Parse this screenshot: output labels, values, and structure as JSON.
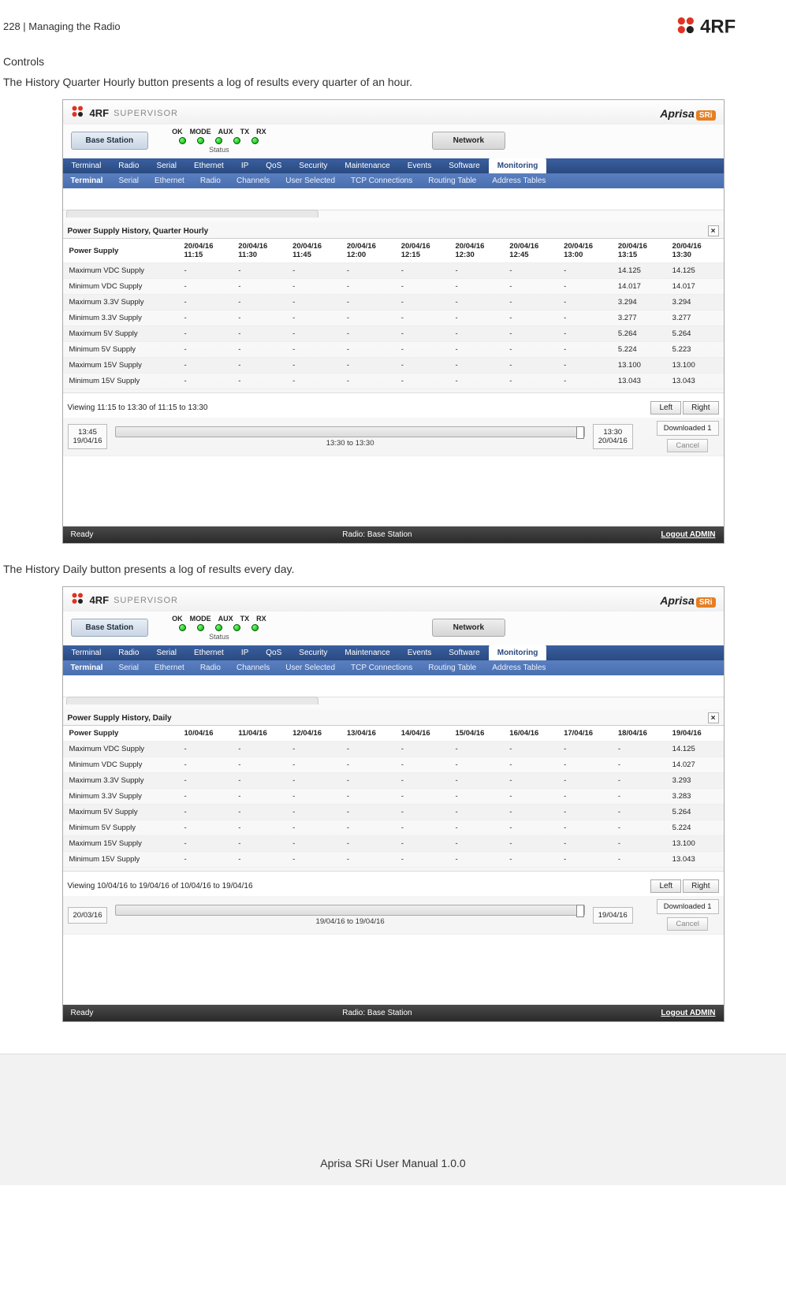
{
  "page_header": {
    "left": "228  |  Managing the Radio"
  },
  "section1": {
    "heading": "Controls",
    "desc": "The History Quarter Hourly button presents a log of results every quarter of an hour."
  },
  "section2": {
    "desc": "The History Daily button presents a log of results every day."
  },
  "app_common": {
    "supervisor": "SUPERVISOR",
    "brand": "Aprisa",
    "brand_suffix": "SRi",
    "base_btn": "Base Station",
    "network_btn": "Network",
    "status_label": "Status",
    "leds": [
      "OK",
      "MODE",
      "AUX",
      "TX",
      "RX"
    ],
    "nav": [
      "Terminal",
      "Radio",
      "Serial",
      "Ethernet",
      "IP",
      "QoS",
      "Security",
      "Maintenance",
      "Events",
      "Software",
      "Monitoring"
    ],
    "subnav": [
      "Terminal",
      "Serial",
      "Ethernet",
      "Radio",
      "Channels",
      "User Selected",
      "TCP Connections",
      "Routing Table",
      "Address Tables"
    ],
    "close_x": "×",
    "left": "Left",
    "right": "Right",
    "downloaded": "Downloaded 1",
    "cancel": "Cancel",
    "ready": "Ready",
    "radio_base": "Radio: Base Station",
    "logout": "Logout ADMIN"
  },
  "panel1": {
    "title": "Power Supply History, Quarter Hourly",
    "row_header": "Power Supply",
    "cols": [
      "20/04/16 11:15",
      "20/04/16 11:30",
      "20/04/16 11:45",
      "20/04/16 12:00",
      "20/04/16 12:15",
      "20/04/16 12:30",
      "20/04/16 12:45",
      "20/04/16 13:00",
      "20/04/16 13:15",
      "20/04/16 13:30"
    ],
    "rows": [
      {
        "name": "Maximum VDC Supply",
        "v": [
          "-",
          "-",
          "-",
          "-",
          "-",
          "-",
          "-",
          "-",
          "14.125",
          "14.125"
        ]
      },
      {
        "name": "Minimum VDC Supply",
        "v": [
          "-",
          "-",
          "-",
          "-",
          "-",
          "-",
          "-",
          "-",
          "14.017",
          "14.017"
        ]
      },
      {
        "name": "Maximum 3.3V Supply",
        "v": [
          "-",
          "-",
          "-",
          "-",
          "-",
          "-",
          "-",
          "-",
          "3.294",
          "3.294"
        ]
      },
      {
        "name": "Minimum 3.3V Supply",
        "v": [
          "-",
          "-",
          "-",
          "-",
          "-",
          "-",
          "-",
          "-",
          "3.277",
          "3.277"
        ]
      },
      {
        "name": "Maximum 5V Supply",
        "v": [
          "-",
          "-",
          "-",
          "-",
          "-",
          "-",
          "-",
          "-",
          "5.264",
          "5.264"
        ]
      },
      {
        "name": "Minimum 5V Supply",
        "v": [
          "-",
          "-",
          "-",
          "-",
          "-",
          "-",
          "-",
          "-",
          "5.224",
          "5.223"
        ]
      },
      {
        "name": "Maximum 15V Supply",
        "v": [
          "-",
          "-",
          "-",
          "-",
          "-",
          "-",
          "-",
          "-",
          "13.100",
          "13.100"
        ]
      },
      {
        "name": "Minimum 15V Supply",
        "v": [
          "-",
          "-",
          "-",
          "-",
          "-",
          "-",
          "-",
          "-",
          "13.043",
          "13.043"
        ]
      }
    ],
    "viewing": "Viewing 11:15 to 13:30 of 11:15 to 13:30",
    "slider_left_top": "13:45",
    "slider_left_bottom": "19/04/16",
    "slider_right_top": "13:30",
    "slider_right_bottom": "20/04/16",
    "slider_caption": "13:30 to 13:30"
  },
  "panel2": {
    "title": "Power Supply History, Daily",
    "row_header": "Power Supply",
    "cols": [
      "10/04/16",
      "11/04/16",
      "12/04/16",
      "13/04/16",
      "14/04/16",
      "15/04/16",
      "16/04/16",
      "17/04/16",
      "18/04/16",
      "19/04/16"
    ],
    "rows": [
      {
        "name": "Maximum VDC Supply",
        "v": [
          "-",
          "-",
          "-",
          "-",
          "-",
          "-",
          "-",
          "-",
          "-",
          "14.125"
        ]
      },
      {
        "name": "Minimum VDC Supply",
        "v": [
          "-",
          "-",
          "-",
          "-",
          "-",
          "-",
          "-",
          "-",
          "-",
          "14.027"
        ]
      },
      {
        "name": "Maximum 3.3V Supply",
        "v": [
          "-",
          "-",
          "-",
          "-",
          "-",
          "-",
          "-",
          "-",
          "-",
          "3.293"
        ]
      },
      {
        "name": "Minimum 3.3V Supply",
        "v": [
          "-",
          "-",
          "-",
          "-",
          "-",
          "-",
          "-",
          "-",
          "-",
          "3.283"
        ]
      },
      {
        "name": "Maximum 5V Supply",
        "v": [
          "-",
          "-",
          "-",
          "-",
          "-",
          "-",
          "-",
          "-",
          "-",
          "5.264"
        ]
      },
      {
        "name": "Minimum 5V Supply",
        "v": [
          "-",
          "-",
          "-",
          "-",
          "-",
          "-",
          "-",
          "-",
          "-",
          "5.224"
        ]
      },
      {
        "name": "Maximum 15V Supply",
        "v": [
          "-",
          "-",
          "-",
          "-",
          "-",
          "-",
          "-",
          "-",
          "-",
          "13.100"
        ]
      },
      {
        "name": "Minimum 15V Supply",
        "v": [
          "-",
          "-",
          "-",
          "-",
          "-",
          "-",
          "-",
          "-",
          "-",
          "13.043"
        ]
      }
    ],
    "viewing": "Viewing 10/04/16 to 19/04/16 of 10/04/16 to 19/04/16",
    "slider_left_top": "20/03/16",
    "slider_right_top": "19/04/16",
    "slider_caption": "19/04/16 to 19/04/16"
  },
  "page_footer": "Aprisa SRi User Manual 1.0.0"
}
